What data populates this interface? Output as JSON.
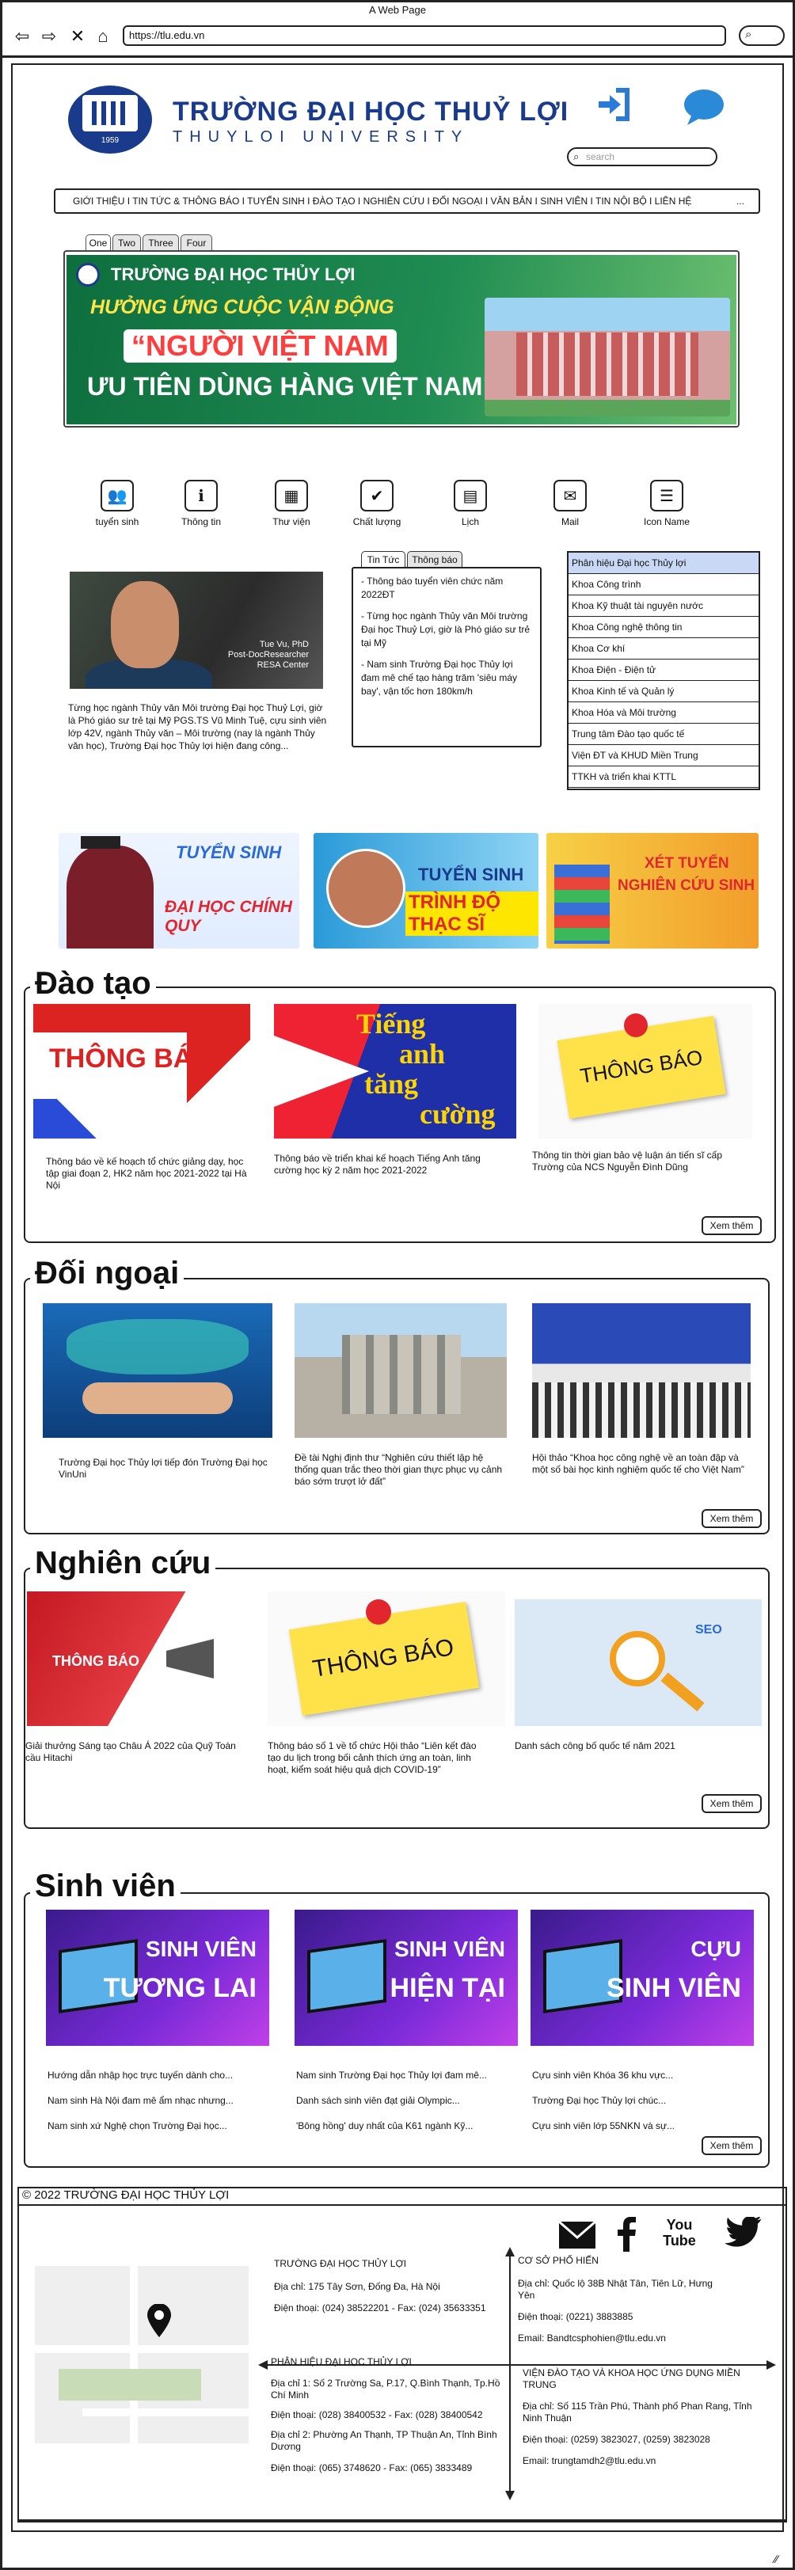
{
  "browser": {
    "title": "A Web Page",
    "url": "https://tlu.edu.vn"
  },
  "header": {
    "logo_year": "1959",
    "brand_vn": "TRƯỜNG ĐẠI HỌC THUỶ LỢI",
    "brand_en": "THUYLOI UNIVERSITY",
    "search_placeholder": "search"
  },
  "nav": {
    "text": "GIỚI THIỆU I TIN TỨC & THÔNG BÁO I TUYỂN SINH I ĐÀO TẠO I NGHIÊN CỨU I ĐỐI NGOẠI I VĂN BẢN I SINH VIÊN I TIN NỘI BỘ I LIÊN HỆ",
    "more": "..."
  },
  "banner": {
    "tabs": [
      "One",
      "Two",
      "Three",
      "Four"
    ],
    "school": "TRƯỜNG ĐẠI HỌC THỦY LỢI",
    "line1": "HƯỞNG ỨNG CUỘC VẬN ĐỘNG",
    "line2": "“NGƯỜI VIỆT NAM",
    "line3": "ƯU TIÊN DÙNG HÀNG VIỆT NAM”"
  },
  "quick_links": [
    {
      "label": "tuyển sinh",
      "icon": "people-icon"
    },
    {
      "label": "Thông tin",
      "icon": "info-person-icon"
    },
    {
      "label": "Thư viện",
      "icon": "library-icon"
    },
    {
      "label": "Chất lượng",
      "icon": "check-circle-icon"
    },
    {
      "label": "Lịch",
      "icon": "calendar-icon"
    },
    {
      "label": "Mail",
      "icon": "mail-icon"
    },
    {
      "label": "Icon Name",
      "icon": "database-icon"
    }
  ],
  "featured": {
    "image_caption": [
      "Tue Vu, PhD",
      "Post-DocResearcher",
      "RESA Center"
    ],
    "text": "Từng học ngành Thủy văn Môi trường Đại học Thuỷ Lợi, giờ là Phó giáo sư trẻ tại Mỹ PGS.TS Vũ Minh Tuệ, cựu sinh viên lớp 42V, ngành Thủy văn – Môi trường (nay là ngành Thủy văn học), Trường Đại học Thủy lợi hiện đang công..."
  },
  "news_tabs": {
    "tabs": [
      "Tin Tức",
      "Thông báo"
    ],
    "items": [
      "- Thông báo tuyển viên chức năm 2022ĐT",
      "- Từng học ngành Thủy văn Môi trường Đại học Thuỷ Lợi, giờ là Phó giáo sư trẻ tại Mỹ",
      "- Nam sinh Trường Đại học Thủy lợi đam mê chế tạo hàng trăm 'siêu máy bay', vận tốc hơn 180km/h"
    ]
  },
  "departments": [
    "Phân hiệu Đại học Thủy lợi",
    "Khoa Công trình",
    "Khoa Kỹ thuật tài nguyên nước",
    "Khoa Công nghệ thông tin",
    "Khoa Cơ khí",
    "Khoa Điện - Điện tử",
    "Khoa Kinh tế và Quản lý",
    "Khoa Hóa và Môi trường",
    "Trung tâm Đào tạo quốc tế",
    "Viện ĐT và KHUD Miền Trung",
    "TTKH và triển khai KTTL"
  ],
  "promos": [
    {
      "top": "TUYỂN SINH",
      "bottom": "ĐẠI HỌC CHÍNH QUY"
    },
    {
      "top": "TUYỂN SINH",
      "bottom": "TRÌNH ĐỘ THẠC SĨ"
    },
    {
      "top": "XÉT TUYỂN",
      "bottom": "NGHIÊN CỨU SINH"
    }
  ],
  "more_label": "Xem thêm",
  "dao_tao": {
    "title": "Đào tạo",
    "cards": [
      {
        "img_text": "THÔNG BÁO",
        "text": "Thông báo về kế hoạch tổ chức giảng dạy, học tập giai đoạn 2, HK2 năm học 2021-2022 tại Hà Nội"
      },
      {
        "img_text": "Tiếng anh tăng cường",
        "img_lines": [
          "Tiếng",
          "anh",
          "tăng",
          "cường"
        ],
        "text": "Thông báo về triển khai kế hoạch Tiếng Anh tăng cường học kỳ 2 năm học 2021-2022"
      },
      {
        "img_text": "THÔNG BÁO",
        "text": "Thông tin thời gian bảo vệ luận án tiến sĩ cấp Trường của NCS Nguyễn Đình Dũng"
      }
    ]
  },
  "doi_ngoai": {
    "title": "Đối ngoại",
    "cards": [
      {
        "text": "Trường Đại học Thủy lợi tiếp đón Trường Đại học VinUni"
      },
      {
        "text": "Đề tài Nghị định thư “Nghiên cứu thiết lập hệ thống quan trắc theo thời gian thực phục vụ cảnh báo sớm trượt lở đất”"
      },
      {
        "text": "Hội thảo “Khoa học công nghệ về an toàn đập và một số bài học kinh nghiệm quốc tế cho Việt Nam”"
      }
    ]
  },
  "nghien_cuu": {
    "title": "Nghiên cứu",
    "cards": [
      {
        "img_text": "THÔNG BÁO",
        "text": "Giải thưởng Sáng tạo Châu Á 2022 của Quỹ Toàn cầu Hitachi"
      },
      {
        "img_text": "THÔNG BÁO",
        "text": "Thông báo số 1 về tổ chức Hội thảo “Liên kết đào tạo du lịch trong bối cảnh thích ứng an toàn, linh hoạt, kiểm soát hiệu quả dịch COVID-19”"
      },
      {
        "img_text": "SEO",
        "text": "Danh sách công bố quốc tế năm 2021"
      }
    ]
  },
  "sinh_vien": {
    "title": "Sinh viên",
    "cards": [
      {
        "img_lines": [
          "SINH VIÊN",
          "TƯƠNG LAI"
        ],
        "links": [
          "Hướng dẫn nhập học trực tuyến dành cho...",
          "Nam sinh Hà Nội đam mê ẩm nhạc nhưng...",
          "Nam sinh xứ Nghệ chọn Trường Đại học..."
        ]
      },
      {
        "img_lines": [
          "SINH VIÊN",
          "HIỆN TẠI"
        ],
        "links": [
          "Nam sinh Trường Đại học Thủy lợi đam mê...",
          "Danh sách sinh viên đạt giải Olympic...",
          "'Bông hồng' duy nhất của K61 ngành Kỹ..."
        ]
      },
      {
        "img_lines": [
          "CỰU",
          "SINH VIÊN"
        ],
        "links": [
          "Cựu sinh viên Khóa 36 khu vực...",
          "Trường Đại học Thủy lợi chúc...",
          "Cựu sinh viên lớp 55NKN và sự..."
        ]
      }
    ]
  },
  "footer": {
    "copyright": "© 2022 TRƯỜNG ĐẠI HỌC THỦY LỢI",
    "hn": {
      "name": "TRƯỜNG ĐẠI HỌC THỦY LỢI",
      "address": "Địa chỉ: 175 Tây Sơn, Đống Đa, Hà Nội",
      "phone": "Điện thoại: (024) 38522201 - Fax: (024) 35633351"
    },
    "ph": {
      "name": "CƠ SỞ PHỐ HIẾN",
      "address": "Địa chỉ: Quốc lộ 38B Nhật Tân, Tiên Lữ, Hưng Yên",
      "phone": "Điện thoại: (0221) 3883885",
      "email": "Email: Bandtcsphohien@tlu.edu.vn"
    },
    "mn": {
      "name": "PHÂN HIỆU ĐẠI HỌC THỦY LỢI",
      "address1": "Địa chỉ 1: Số 2 Trường Sa, P.17, Q.Bình Thạnh, Tp.Hồ Chí Minh",
      "phone1": "Điện thoại: (028) 38400532 - Fax: (028) 38400542",
      "address2": "Địa chỉ 2: Phường An Thạnh, TP Thuận An, Tỉnh Bình Dương",
      "phone2": "Điện thoại: (065) 3748620 - Fax: (065) 3833489"
    },
    "mt": {
      "name": "VIỆN ĐÀO TẠO VÀ KHOA HỌC ỨNG DỤNG MIỀN TRUNG",
      "address": "Địa chỉ: Số 115 Trần Phú, Thành phố Phan Rang, Tỉnh Ninh Thuận",
      "phone": "Điện thoại: (0259) 3823027, (0259) 3823028",
      "email": "Email: trungtamdh2@tlu.edu.vn"
    },
    "social": [
      "mail-icon",
      "facebook-icon",
      "youtube-icon",
      "twitter-icon"
    ],
    "youtube_label": "You Tube"
  }
}
